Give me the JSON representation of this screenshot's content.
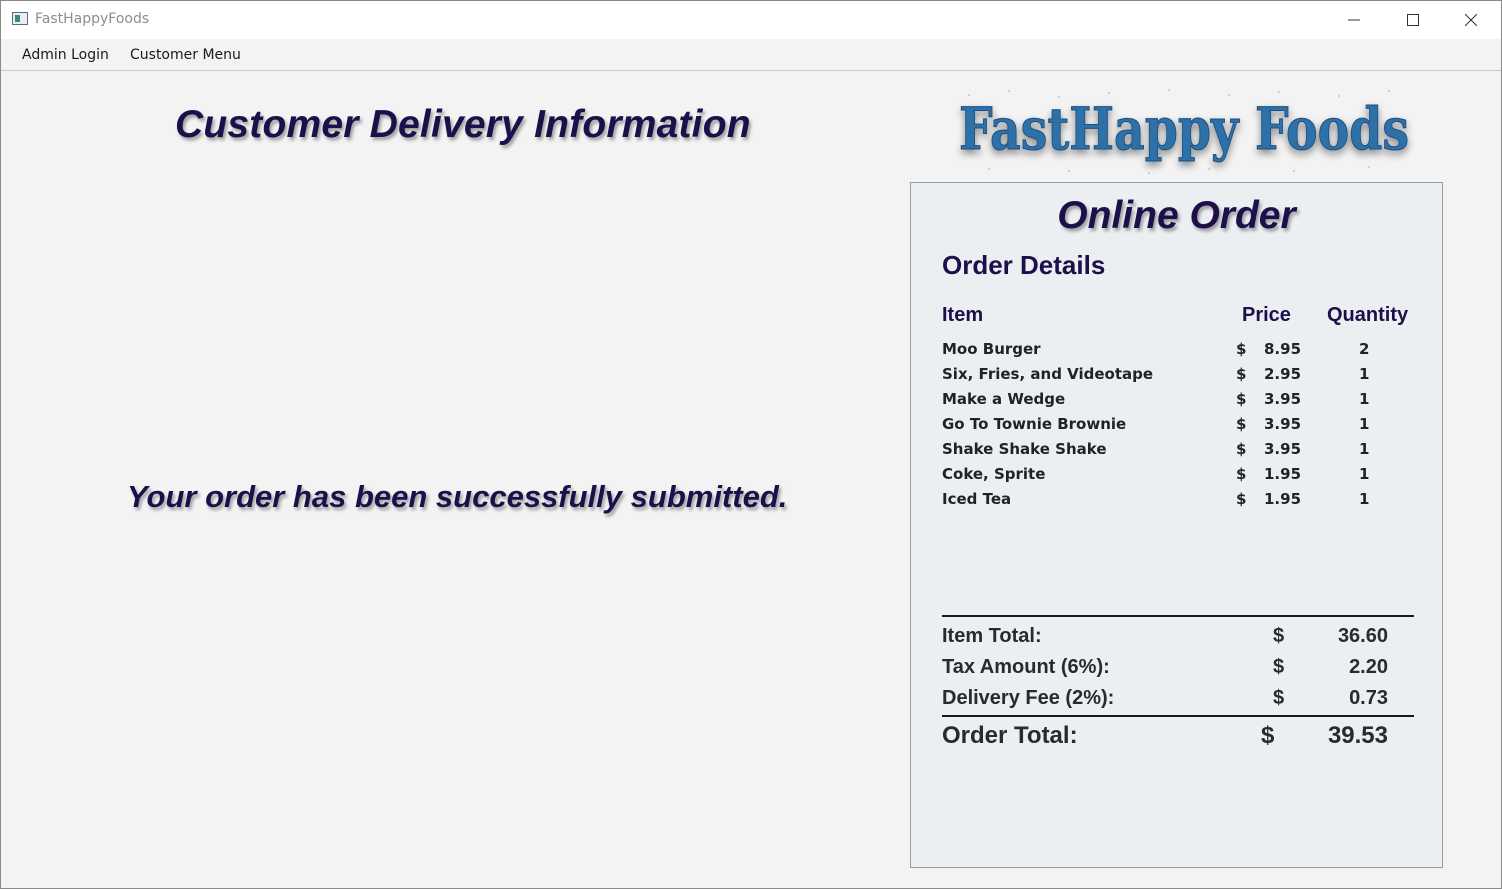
{
  "window": {
    "title": "FastHappyFoods"
  },
  "menu": {
    "items": [
      "Admin Login",
      "Customer Menu"
    ]
  },
  "main": {
    "title": "Customer Delivery Information",
    "message": "Your order has been successfully submitted."
  },
  "logo": {
    "text": "FastHappy Foods",
    "color": "#2d6fa8"
  },
  "order": {
    "heading": "Online Order",
    "subheading": "Order Details",
    "columns": {
      "item": "Item",
      "price": "Price",
      "quantity": "Quantity"
    },
    "currency_symbol": "$",
    "items": [
      {
        "name": "Moo Burger",
        "price": "8.95",
        "quantity": "2"
      },
      {
        "name": "Six, Fries, and Videotape",
        "price": "2.95",
        "quantity": "1"
      },
      {
        "name": "Make a Wedge",
        "price": "3.95",
        "quantity": "1"
      },
      {
        "name": "Go To Townie Brownie",
        "price": "3.95",
        "quantity": "1"
      },
      {
        "name": "Shake Shake Shake",
        "price": "3.95",
        "quantity": "1"
      },
      {
        "name": "Coke, Sprite",
        "price": "1.95",
        "quantity": "1"
      },
      {
        "name": "Iced Tea",
        "price": "1.95",
        "quantity": "1"
      }
    ],
    "summary": [
      {
        "label": "Item Total:",
        "value": "36.60"
      },
      {
        "label": "Tax Amount (6%):",
        "value": "2.20"
      },
      {
        "label": "Delivery Fee (2%):",
        "value": "0.73"
      }
    ],
    "total": {
      "label": "Order Total:",
      "value": "39.53"
    }
  },
  "colors": {
    "heading": "#1c0f4a",
    "panel_bg": "#eceff2",
    "window_bg": "#f3f3f3"
  }
}
